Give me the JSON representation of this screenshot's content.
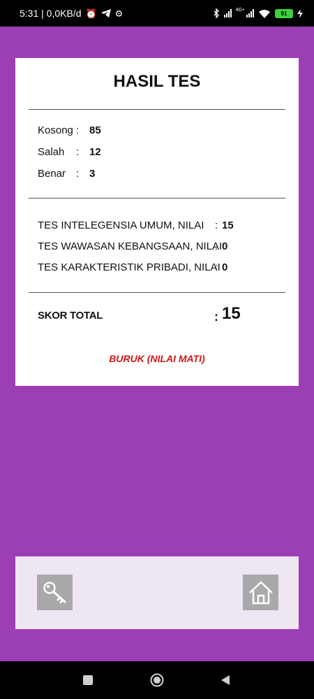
{
  "status_bar": {
    "time_speed": "5:31 | 0,0KB/d",
    "network_type": "4G+",
    "battery_level": "91"
  },
  "result": {
    "title": "HASIL TES",
    "sep": ":",
    "answers": [
      {
        "label": "Kosong",
        "value": "85"
      },
      {
        "label": "Salah",
        "value": "12"
      },
      {
        "label": "Benar",
        "value": "3"
      }
    ],
    "tests": [
      {
        "label": "TES INTELEGENSIA UMUM, NILAI",
        "value": "15"
      },
      {
        "label": "TES WAWASAN KEBANGSAAN, NILAI",
        "value": "0"
      },
      {
        "label": "TES KARAKTERISTIK PRIBADI, NILAI",
        "value": "0"
      }
    ],
    "total_label": "SKOR TOTAL",
    "total_value": "15",
    "verdict": "BURUK (NILAI MATI)"
  },
  "colors": {
    "background": "#9c3fb5",
    "card": "#ffffff",
    "verdict": "#d01818",
    "bottom_panel": "#efe6f4",
    "icon_button": "#a9a9a9"
  },
  "icons": {
    "left_button": "key-icon",
    "right_button": "home-icon"
  }
}
